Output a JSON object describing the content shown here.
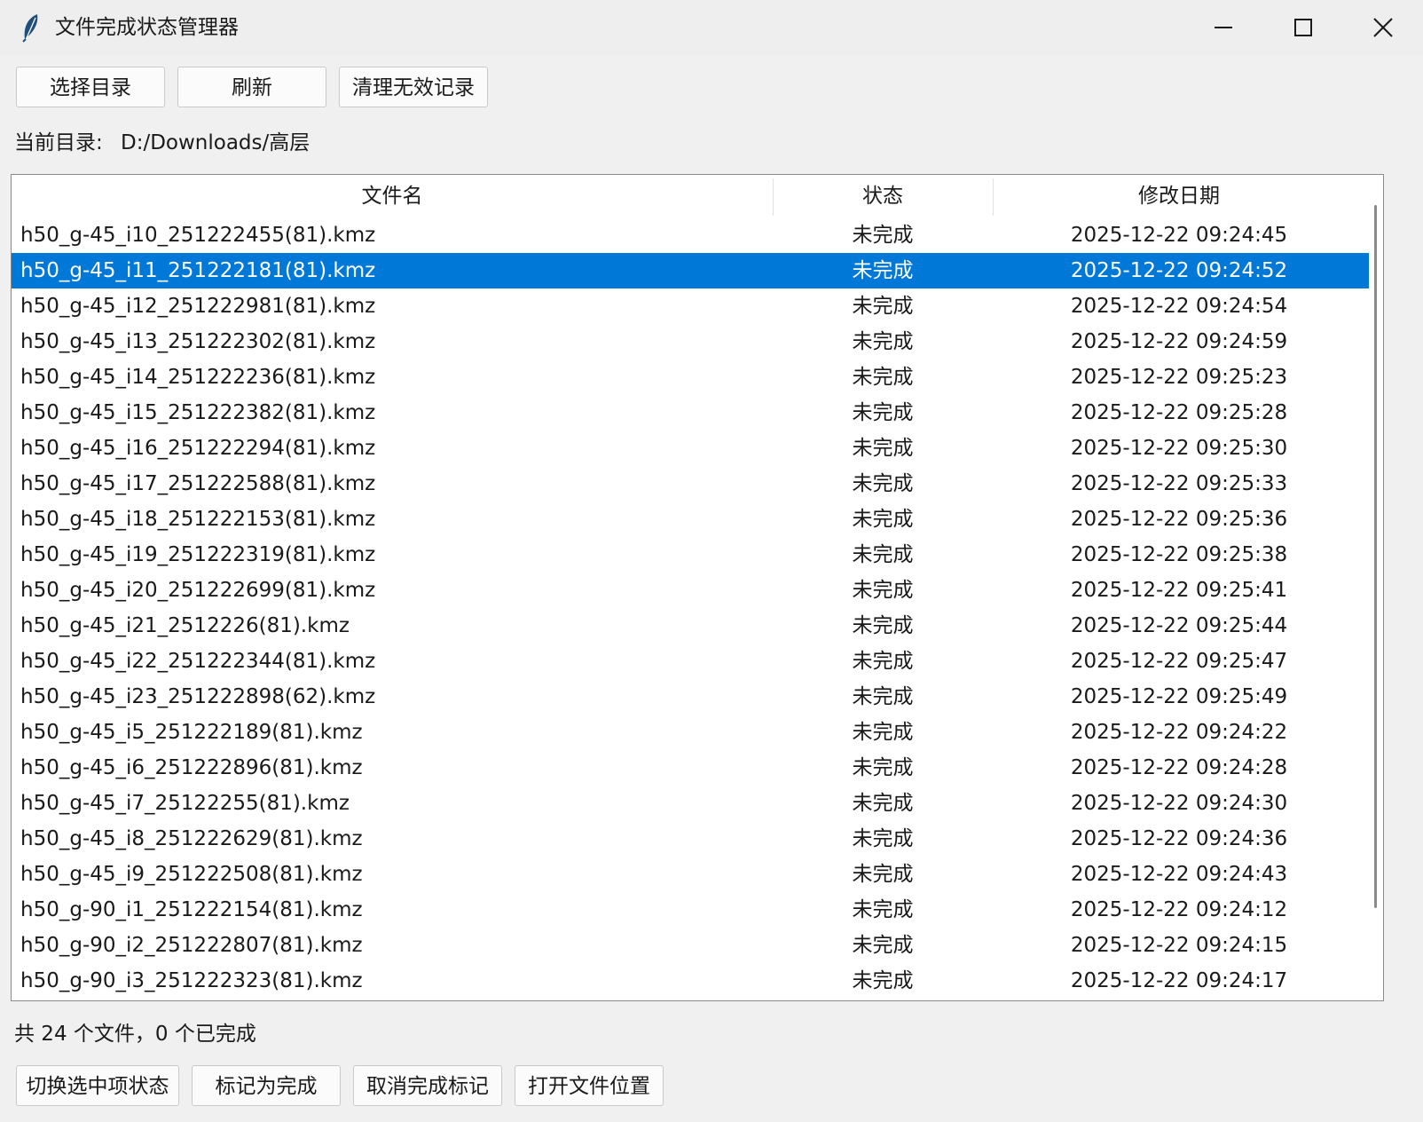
{
  "window": {
    "title": "文件完成状态管理器",
    "controls": [
      "minimize-icon",
      "maximize-icon",
      "close-icon"
    ]
  },
  "toolbar": {
    "select_dir": "选择目录",
    "refresh": "刷新",
    "clean_invalid": "清理无效记录"
  },
  "current_dir": {
    "label": "当前目录:",
    "value": "D:/Downloads/高层"
  },
  "table": {
    "columns": [
      "文件名",
      "状态",
      "修改日期"
    ],
    "selected_index": 1,
    "rows": [
      {
        "name": "h50_g-45_i10_251222455(81).kmz",
        "status": "未完成",
        "date": "2025-12-22 09:24:45"
      },
      {
        "name": "h50_g-45_i11_251222181(81).kmz",
        "status": "未完成",
        "date": "2025-12-22 09:24:52"
      },
      {
        "name": "h50_g-45_i12_251222981(81).kmz",
        "status": "未完成",
        "date": "2025-12-22 09:24:54"
      },
      {
        "name": "h50_g-45_i13_251222302(81).kmz",
        "status": "未完成",
        "date": "2025-12-22 09:24:59"
      },
      {
        "name": "h50_g-45_i14_251222236(81).kmz",
        "status": "未完成",
        "date": "2025-12-22 09:25:23"
      },
      {
        "name": "h50_g-45_i15_251222382(81).kmz",
        "status": "未完成",
        "date": "2025-12-22 09:25:28"
      },
      {
        "name": "h50_g-45_i16_251222294(81).kmz",
        "status": "未完成",
        "date": "2025-12-22 09:25:30"
      },
      {
        "name": "h50_g-45_i17_251222588(81).kmz",
        "status": "未完成",
        "date": "2025-12-22 09:25:33"
      },
      {
        "name": "h50_g-45_i18_251222153(81).kmz",
        "status": "未完成",
        "date": "2025-12-22 09:25:36"
      },
      {
        "name": "h50_g-45_i19_251222319(81).kmz",
        "status": "未完成",
        "date": "2025-12-22 09:25:38"
      },
      {
        "name": "h50_g-45_i20_251222699(81).kmz",
        "status": "未完成",
        "date": "2025-12-22 09:25:41"
      },
      {
        "name": "h50_g-45_i21_2512226(81).kmz",
        "status": "未完成",
        "date": "2025-12-22 09:25:44"
      },
      {
        "name": "h50_g-45_i22_251222344(81).kmz",
        "status": "未完成",
        "date": "2025-12-22 09:25:47"
      },
      {
        "name": "h50_g-45_i23_251222898(62).kmz",
        "status": "未完成",
        "date": "2025-12-22 09:25:49"
      },
      {
        "name": "h50_g-45_i5_251222189(81).kmz",
        "status": "未完成",
        "date": "2025-12-22 09:24:22"
      },
      {
        "name": "h50_g-45_i6_251222896(81).kmz",
        "status": "未完成",
        "date": "2025-12-22 09:24:28"
      },
      {
        "name": "h50_g-45_i7_25122255(81).kmz",
        "status": "未完成",
        "date": "2025-12-22 09:24:30"
      },
      {
        "name": "h50_g-45_i8_251222629(81).kmz",
        "status": "未完成",
        "date": "2025-12-22 09:24:36"
      },
      {
        "name": "h50_g-45_i9_251222508(81).kmz",
        "status": "未完成",
        "date": "2025-12-22 09:24:43"
      },
      {
        "name": "h50_g-90_i1_251222154(81).kmz",
        "status": "未完成",
        "date": "2025-12-22 09:24:12"
      },
      {
        "name": "h50_g-90_i2_251222807(81).kmz",
        "status": "未完成",
        "date": "2025-12-22 09:24:15"
      },
      {
        "name": "h50_g-90_i3_251222323(81).kmz",
        "status": "未完成",
        "date": "2025-12-22 09:24:17"
      }
    ]
  },
  "summary": "共 24 个文件，0 个已完成",
  "actions": {
    "toggle_selected": "切换选中项状态",
    "mark_done": "标记为完成",
    "unmark_done": "取消完成标记",
    "open_location": "打开文件位置"
  },
  "colors": {
    "selection": "#0078d7",
    "window_bg": "#f0f0f0",
    "table_bg": "#ffffff"
  }
}
